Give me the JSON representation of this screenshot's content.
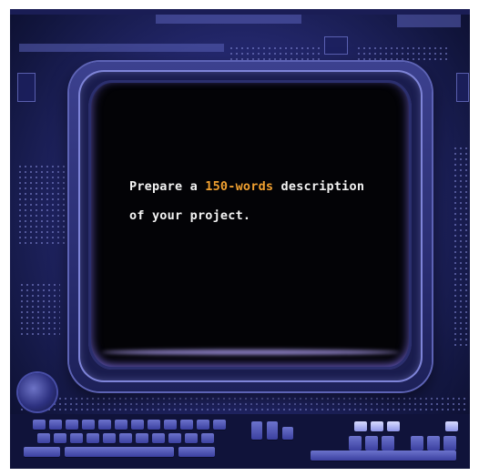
{
  "message": {
    "before": "Prepare a ",
    "highlight": "150-words",
    "after": " description",
    "line2": "of your project."
  },
  "colors": {
    "highlight": "#f0a030",
    "text": "#f2f2f2",
    "screen": "#030306",
    "board": "#24286e"
  }
}
